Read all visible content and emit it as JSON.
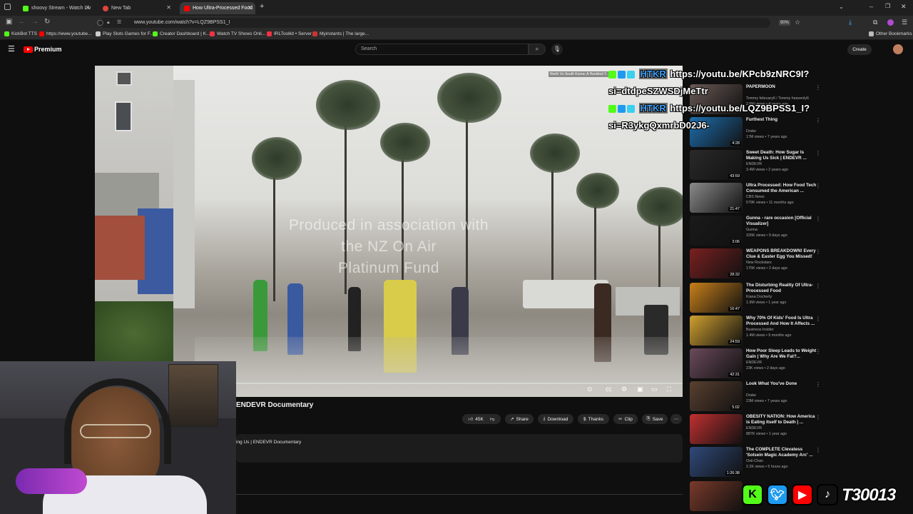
{
  "browser": {
    "tabs": [
      {
        "title": "shoovy Stream - Watch Liv",
        "active": false
      },
      {
        "title": "New Tab",
        "active": false
      },
      {
        "title": "How Ultra-Processed Food",
        "active": true
      }
    ],
    "url": "www.youtube.com/watch?v=LQZ9BPSS1_I",
    "zoom": "90%",
    "bookmarks": [
      "KickBot TTS",
      "https://www.youtube...",
      "Play Slots Games for F...",
      "Creator Dashboard | K...",
      "Watch TV Shows Onli...",
      "IRLToolkit • Server",
      "Myinstants | The large..."
    ],
    "other_bookmarks": "Other Bookmarks"
  },
  "youtube": {
    "brand": "Premium",
    "search_placeholder": "Search",
    "create_label": "Create"
  },
  "player": {
    "overlay_lines": [
      "Produced in association with",
      "the NZ On Air",
      "Platinum Fund"
    ],
    "next_up": "North Vs South Korea: A Hundred Y..."
  },
  "video": {
    "channel_title": "ENDEVR Documentary",
    "likes": "45K",
    "actions": [
      "Share",
      "Download",
      "Thanks",
      "Clip",
      "Save"
    ],
    "desc_line": "ing Us | ENDEVR Documentary"
  },
  "recommendations": [
    {
      "title": "PAPERMOON",
      "channel": "Tommy february6 / Tommy heavenly6",
      "meta": "2.6M views • 4 years ago",
      "duration": "",
      "color": "#6a5a55"
    },
    {
      "title": "Furthest Thing",
      "channel": "Drake",
      "meta": "17M views • 7 years ago",
      "duration": "4:28",
      "color": "#1e6fb0"
    },
    {
      "title": "Sweet Death: How Sugar Is Making Us Sick | ENDEVR ...",
      "channel": "ENDEVR",
      "meta": "3.4M views • 2 years ago",
      "duration": "43:59",
      "color": "#2a2a2a"
    },
    {
      "title": "Ultra Processed: How Food Tech Consumed the American ...",
      "channel": "CBS News",
      "meta": "579K views • 11 months ago",
      "duration": "21:47",
      "color": "#8a8a8a"
    },
    {
      "title": "Gunna - rare occasion [Official Visualizer]",
      "channel": "Gunna",
      "meta": "326K views • 9 days ago",
      "duration": "3:06",
      "color": "#1a1a1a"
    },
    {
      "title": "WEAPONS BREAKDOWN! Every Clue & Easter Egg You Missed!",
      "channel": "New Rockstars",
      "meta": "175K views • 2 days ago",
      "duration": "28:32",
      "color": "#7a2020"
    },
    {
      "title": "The Disturbing Reality Of Ultra-Processed Food",
      "channel": "Kiana Docherty",
      "meta": "1.9M views • 1 year ago",
      "duration": "16:47",
      "color": "#c8801a"
    },
    {
      "title": "Why 70% Of Kids' Food Is Ultra Processed And How It Affects ...",
      "channel": "Business Insider",
      "meta": "1.4M views • 9 months ago",
      "duration": "24:59",
      "color": "#d0a030"
    },
    {
      "title": "How Poor Sleep Leads to Weight Gain | Why Are We Fat?...",
      "channel": "ENDEVR",
      "meta": "23K views • 2 days ago",
      "duration": "42:31",
      "color": "#6a4a5a"
    },
    {
      "title": "Look What You've Done",
      "channel": "Drake",
      "meta": "23M views • 7 years ago",
      "duration": "5:02",
      "color": "#5a4030"
    },
    {
      "title": "OBESITY NATION: How America is Eating itself to Death | ...",
      "channel": "ENDEVR",
      "meta": "887K views • 1 year ago",
      "duration": "",
      "color": "#c03030"
    },
    {
      "title": "The COMPLETE Clevatess 'Solsein Magic Academy Arc' ...",
      "channel": "Onii-Chan",
      "meta": "2.2K views • 5 hours ago",
      "duration": "1:26:38",
      "color": "#304a7a"
    },
    {
      "title": "",
      "channel": "",
      "meta": "",
      "duration": "",
      "color": "#7a3a2a"
    }
  ],
  "chat_overlay": [
    {
      "user": "HTKR",
      "text": "https://youtu.be/KPcb9zNRC9I?",
      "text2": "si=dtdpeSZWSDjMeTtr"
    },
    {
      "user": "HTKR",
      "text": "https://youtu.be/LQZ9BPSS1_I?",
      "text2": "si=R3ykgQxmrbD02J6-"
    }
  ],
  "streamer_handle": "T30013",
  "colors": {
    "kick": "#53fc18",
    "twitter": "#1d9bf0",
    "youtube": "#ff0000",
    "tiktok": "#111111",
    "yt_red": "#ff0000"
  }
}
